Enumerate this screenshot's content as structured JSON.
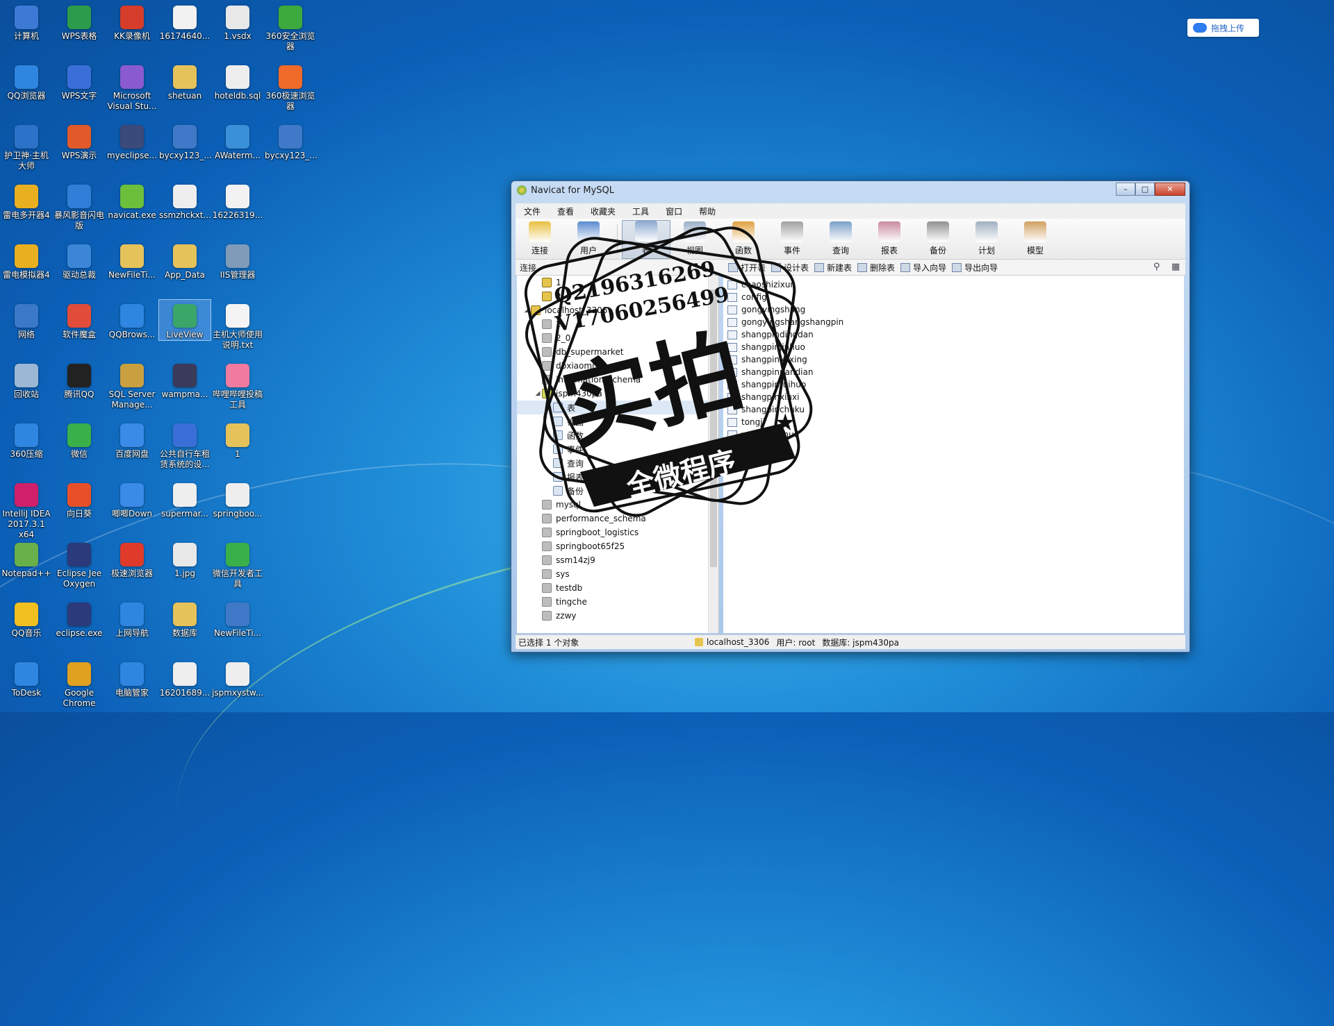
{
  "desktop": {
    "upload_button": "拖拽上传",
    "icons": [
      {
        "label": "计算机",
        "color": "#3d7ad6",
        "x": 0,
        "y": 0
      },
      {
        "label": "WPS表格",
        "color": "#2c9b4b",
        "x": 1,
        "y": 0
      },
      {
        "label": "KK录像机",
        "color": "#d63c2a",
        "x": 2,
        "y": 0
      },
      {
        "label": "16174640...",
        "color": "#f2f2f2",
        "x": 3,
        "y": 0
      },
      {
        "label": "1.vsdx",
        "color": "#e8e8e8",
        "x": 4,
        "y": 0
      },
      {
        "label": "360安全浏览器",
        "color": "#3caa3c",
        "x": 5,
        "y": 0
      },
      {
        "label": "QQ浏览器",
        "color": "#2f86e0",
        "x": 0,
        "y": 1
      },
      {
        "label": "WPS文字",
        "color": "#3a6fd8",
        "x": 1,
        "y": 1
      },
      {
        "label": "Microsoft Visual Stu...",
        "color": "#8a5bd0",
        "x": 2,
        "y": 1
      },
      {
        "label": "shetuan",
        "color": "#e6c25a",
        "x": 3,
        "y": 1
      },
      {
        "label": "hoteldb.sql",
        "color": "#eeeeee",
        "x": 4,
        "y": 1
      },
      {
        "label": "360极速浏览器",
        "color": "#f06a2a",
        "x": 5,
        "y": 1
      },
      {
        "label": "护卫神·主机大师",
        "color": "#2b72c8",
        "x": 0,
        "y": 2
      },
      {
        "label": "WPS演示",
        "color": "#e25a2a",
        "x": 1,
        "y": 2
      },
      {
        "label": "myeclipse...",
        "color": "#3a4a7a",
        "x": 2,
        "y": 2
      },
      {
        "label": "bycxy123_...",
        "color": "#3f79c8",
        "x": 3,
        "y": 2
      },
      {
        "label": "AWaterm...",
        "color": "#3a90d8",
        "x": 4,
        "y": 2
      },
      {
        "label": "bycxy123_...",
        "color": "#3f79c8",
        "x": 5,
        "y": 2
      },
      {
        "label": "雷电多开器4",
        "color": "#e8b020",
        "x": 0,
        "y": 3
      },
      {
        "label": "暴风影音闪电版",
        "color": "#2f7fd8",
        "x": 1,
        "y": 3
      },
      {
        "label": "navicat.exe",
        "color": "#6bbf3a",
        "x": 2,
        "y": 3
      },
      {
        "label": "ssmzhckxt...",
        "color": "#eeeeee",
        "x": 3,
        "y": 3
      },
      {
        "label": "16226319...",
        "color": "#f2f2f2",
        "x": 4,
        "y": 3
      },
      {
        "label": "雷电模拟器4",
        "color": "#e8b020",
        "x": 0,
        "y": 4
      },
      {
        "label": "驱动总裁",
        "color": "#3b86d6",
        "x": 1,
        "y": 4
      },
      {
        "label": "NewFileTi...",
        "color": "#e6c25a",
        "x": 2,
        "y": 4
      },
      {
        "label": "App_Data",
        "color": "#e6c25a",
        "x": 3,
        "y": 4
      },
      {
        "label": "IIS管理器",
        "color": "#7f9bb8",
        "x": 4,
        "y": 4
      },
      {
        "label": "网络",
        "color": "#3a78c8",
        "x": 0,
        "y": 5
      },
      {
        "label": "软件魔盒",
        "color": "#e24c3a",
        "x": 1,
        "y": 5
      },
      {
        "label": "QQBrows...",
        "color": "#2f86e0",
        "x": 2,
        "y": 5
      },
      {
        "label": "LiveView",
        "color": "#3aa66a",
        "x": 3,
        "y": 5,
        "selected": true
      },
      {
        "label": "主机大师使用说明.txt",
        "color": "#f4f4f4",
        "x": 4,
        "y": 5
      },
      {
        "label": "回收站",
        "color": "#9ab8d6",
        "x": 0,
        "y": 6
      },
      {
        "label": "腾讯QQ",
        "color": "#222222",
        "x": 1,
        "y": 6
      },
      {
        "label": "SQL Server Manage...",
        "color": "#c8a040",
        "x": 2,
        "y": 6
      },
      {
        "label": "wampma...",
        "color": "#3a3a5a",
        "x": 3,
        "y": 6
      },
      {
        "label": "哔哩哔哩投稿工具",
        "color": "#f07aa0",
        "x": 4,
        "y": 6
      },
      {
        "label": "360压缩",
        "color": "#2f86e0",
        "x": 0,
        "y": 7
      },
      {
        "label": "微信",
        "color": "#3ab04a",
        "x": 1,
        "y": 7
      },
      {
        "label": "百度网盘",
        "color": "#3a8ae8",
        "x": 2,
        "y": 7
      },
      {
        "label": "公共自行车租赁系统的设...",
        "color": "#3a6fd8",
        "x": 3,
        "y": 7
      },
      {
        "label": "1",
        "color": "#e6c25a",
        "x": 4,
        "y": 7
      },
      {
        "label": "IntelliJ IDEA 2017.3.1 x64",
        "color": "#d0206a",
        "x": 0,
        "y": 8
      },
      {
        "label": "向日葵",
        "color": "#e8502a",
        "x": 1,
        "y": 8
      },
      {
        "label": "唧唧Down",
        "color": "#3a8ae8",
        "x": 2,
        "y": 8
      },
      {
        "label": "supermar...",
        "color": "#eeeeee",
        "x": 3,
        "y": 8
      },
      {
        "label": "springboo...",
        "color": "#eeeeee",
        "x": 4,
        "y": 8
      },
      {
        "label": "Notepad++",
        "color": "#6ab04a",
        "x": 0,
        "y": 9
      },
      {
        "label": "Eclipse Jee Oxygen",
        "color": "#2a3a7a",
        "x": 1,
        "y": 9
      },
      {
        "label": "极速浏览器",
        "color": "#e03a2a",
        "x": 2,
        "y": 9
      },
      {
        "label": "1.jpg",
        "color": "#e8e8e8",
        "x": 3,
        "y": 9
      },
      {
        "label": "微信开发者工具",
        "color": "#3ab04a",
        "x": 4,
        "y": 9
      },
      {
        "label": "QQ音乐",
        "color": "#f0c020",
        "x": 0,
        "y": 10
      },
      {
        "label": "eclipse.exe",
        "color": "#2a3a7a",
        "x": 1,
        "y": 10
      },
      {
        "label": "上网导航",
        "color": "#2f86e0",
        "x": 2,
        "y": 10
      },
      {
        "label": "数据库",
        "color": "#e6c25a",
        "x": 3,
        "y": 10
      },
      {
        "label": "NewFileTi...",
        "color": "#3f79c8",
        "x": 4,
        "y": 10
      },
      {
        "label": "ToDesk",
        "color": "#2f86e0",
        "x": 0,
        "y": 11
      },
      {
        "label": "Google Chrome",
        "color": "#e0a020",
        "x": 1,
        "y": 11
      },
      {
        "label": "电脑管家",
        "color": "#2f86e0",
        "x": 2,
        "y": 11
      },
      {
        "label": "16201689...",
        "color": "#eeeeee",
        "x": 3,
        "y": 11
      },
      {
        "label": "jspmxystw...",
        "color": "#eeeeee",
        "x": 4,
        "y": 11
      }
    ]
  },
  "window": {
    "title": "Navicat for MySQL",
    "menu": [
      "文件",
      "查看",
      "收藏夹",
      "工具",
      "窗口",
      "帮助"
    ],
    "toolbar": [
      {
        "label": "连接",
        "icon": "connection-icon",
        "color": "#e8c040"
      },
      {
        "label": "用户",
        "icon": "user-icon",
        "color": "#5a8ad0"
      },
      {
        "label": "表",
        "icon": "table-icon",
        "color": "#8aa8d0",
        "active": true
      },
      {
        "label": "视图",
        "icon": "view-icon",
        "color": "#9ab0c8"
      },
      {
        "label": "函数",
        "icon": "function-icon",
        "color": "#e0a040"
      },
      {
        "label": "事件",
        "icon": "event-icon",
        "color": "#a0a0a0"
      },
      {
        "label": "查询",
        "icon": "query-icon",
        "color": "#7aa0c8"
      },
      {
        "label": "报表",
        "icon": "report-icon",
        "color": "#c88aa0"
      },
      {
        "label": "备份",
        "icon": "backup-icon",
        "color": "#909090"
      },
      {
        "label": "计划",
        "icon": "schedule-icon",
        "color": "#a0b0c0"
      },
      {
        "label": "模型",
        "icon": "model-icon",
        "color": "#d0a060"
      }
    ],
    "subtoolbar": {
      "left_label": "连接",
      "actions": [
        "打开表",
        "设计表",
        "新建表",
        "删除表",
        "导入向导",
        "导出向导"
      ]
    },
    "tree": [
      {
        "label": "1",
        "level": 1,
        "type": "conn"
      },
      {
        "label": "2",
        "level": 1,
        "type": "conn"
      },
      {
        "label": "localhost_3306",
        "level": 0,
        "type": "conn",
        "expanded": true
      },
      {
        "label": "2",
        "level": 1,
        "type": "db"
      },
      {
        "label": "2_0",
        "level": 1,
        "type": "db"
      },
      {
        "label": "db_supermarket",
        "level": 1,
        "type": "db"
      },
      {
        "label": "dbxiaomi",
        "level": 1,
        "type": "db"
      },
      {
        "label": "information_schema",
        "level": 1,
        "type": "db"
      },
      {
        "label": "jspm430pa",
        "level": 1,
        "type": "dbopen",
        "expanded": true
      },
      {
        "label": "表",
        "level": 2,
        "type": "cat",
        "highlight": true,
        "collapsed": true
      },
      {
        "label": "视图",
        "level": 2,
        "type": "cat"
      },
      {
        "label": "函数",
        "level": 2,
        "type": "cat"
      },
      {
        "label": "事件",
        "level": 2,
        "type": "cat"
      },
      {
        "label": "查询",
        "level": 2,
        "type": "cat"
      },
      {
        "label": "报表",
        "level": 2,
        "type": "cat"
      },
      {
        "label": "备份",
        "level": 2,
        "type": "cat"
      },
      {
        "label": "mysql",
        "level": 1,
        "type": "db"
      },
      {
        "label": "performance_schema",
        "level": 1,
        "type": "db"
      },
      {
        "label": "springboot_logistics",
        "level": 1,
        "type": "db"
      },
      {
        "label": "springboot65f25",
        "level": 1,
        "type": "db"
      },
      {
        "label": "ssm14zj9",
        "level": 1,
        "type": "db"
      },
      {
        "label": "sys",
        "level": 1,
        "type": "db"
      },
      {
        "label": "testdb",
        "level": 1,
        "type": "db"
      },
      {
        "label": "tingche",
        "level": 1,
        "type": "db"
      },
      {
        "label": "zzwy",
        "level": 1,
        "type": "db"
      }
    ],
    "tables": [
      "chaoshizixun",
      "config",
      "gongyingshang",
      "gongyingshangshangpin",
      "shangpindingdan",
      "shangpinjinhuo",
      "shangpinleixing",
      "shangpinpandian",
      "shangpintuihuo",
      "shangpinxinxi",
      "shangpinchuku",
      "tongji",
      "yonghutuihuo"
    ],
    "status": {
      "selection": "已选择 1 个对象",
      "connection": "localhost_3306",
      "user": "用户: root",
      "database": "数据库: jspm430pa"
    }
  },
  "watermark": {
    "line1": "Q2196316269",
    "line2": "V17060256499",
    "big_text": "实拍",
    "banner": "全微程序"
  }
}
